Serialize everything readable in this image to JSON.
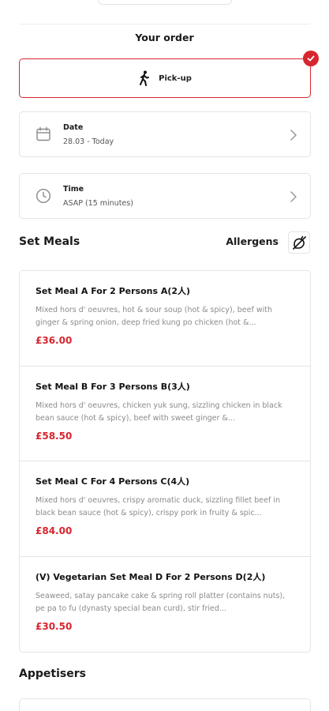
{
  "header": {
    "order_title": "Your order"
  },
  "fulfilment": {
    "label": "Pick-up",
    "selected": true
  },
  "date": {
    "title": "Date",
    "value": "28.03 - Today"
  },
  "time": {
    "title": "Time",
    "value": "ASAP (15 minutes)"
  },
  "set_meals": {
    "title": "Set Meals",
    "allergens_label": "Allergens",
    "items": [
      {
        "name": "Set Meal A For 2 Persons A(2人)",
        "description": "Mixed hors d' oeuvres, hot & sour soup (hot & spicy), beef with ginger & spring onion, deep fried kung po chicken (hot &...",
        "price": "£36.00"
      },
      {
        "name": "Set Meal B For 3 Persons B(3人)",
        "description": "Mixed hors d' oeuvres, chicken yuk sung, sizzling chicken in black bean sauce (hot & spicy), beef with sweet ginger &...",
        "price": "£58.50"
      },
      {
        "name": "Set Meal C For 4 Persons C(4人)",
        "description": "Mixed hors d' oeuvres, crispy aromatic duck, sizzling fillet beef in black bean sauce (hot & spicy), crispy pork in fruity & spic...",
        "price": "£84.00"
      },
      {
        "name": "(V) Vegetarian Set Meal D For 2 Persons D(2人)",
        "description": "Seaweed, satay pancake cake & spring roll platter (contains nuts), pe pa to fu (dynasty special bean curd), stir fried...",
        "price": "£30.50"
      }
    ]
  },
  "appetisers": {
    "title": "Appetisers"
  },
  "icons": {
    "pickup": "walking-person-icon",
    "selected": "checkmark-icon",
    "date": "calendar-icon",
    "time": "clock-icon",
    "chevron": "chevron-right-icon",
    "allergens": "allergens-icon"
  },
  "colors": {
    "accent": "#d7262f",
    "border": "#e4e4e4",
    "muted": "#8a8a8a"
  }
}
